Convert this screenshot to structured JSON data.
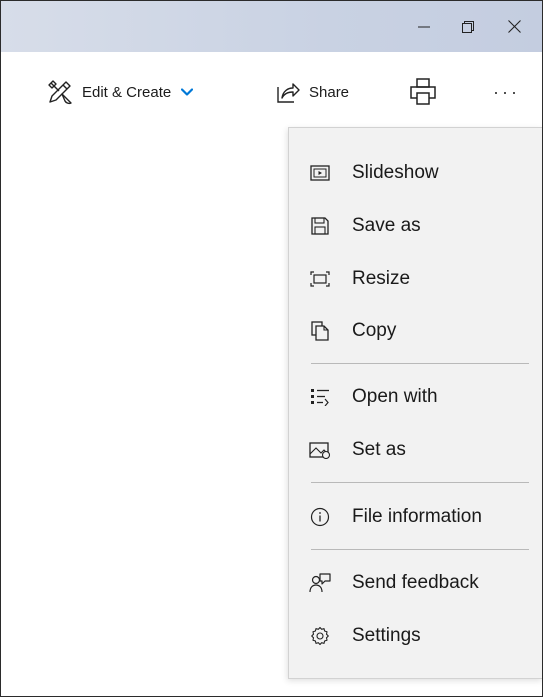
{
  "window": {
    "controls": {
      "minimize_icon": "minimize-icon",
      "maximize_icon": "restore-icon",
      "close_icon": "close-icon"
    },
    "titlebar_color": "#cdd5e5"
  },
  "toolbar": {
    "edit_create_label": "Edit & Create",
    "share_label": "Share",
    "more_label": "···",
    "accent_color": "#0078d7"
  },
  "menu": {
    "items": [
      {
        "label": "Slideshow",
        "icon": "slideshow-icon"
      },
      {
        "label": "Save as",
        "icon": "save-icon"
      },
      {
        "label": "Resize",
        "icon": "resize-icon"
      },
      {
        "label": "Copy",
        "icon": "copy-icon"
      },
      {
        "label": "Open with",
        "icon": "open-with-icon"
      },
      {
        "label": "Set as",
        "icon": "set-as-icon"
      },
      {
        "label": "File information",
        "icon": "info-icon"
      },
      {
        "label": "Send feedback",
        "icon": "feedback-icon"
      },
      {
        "label": "Settings",
        "icon": "gear-icon"
      }
    ]
  }
}
